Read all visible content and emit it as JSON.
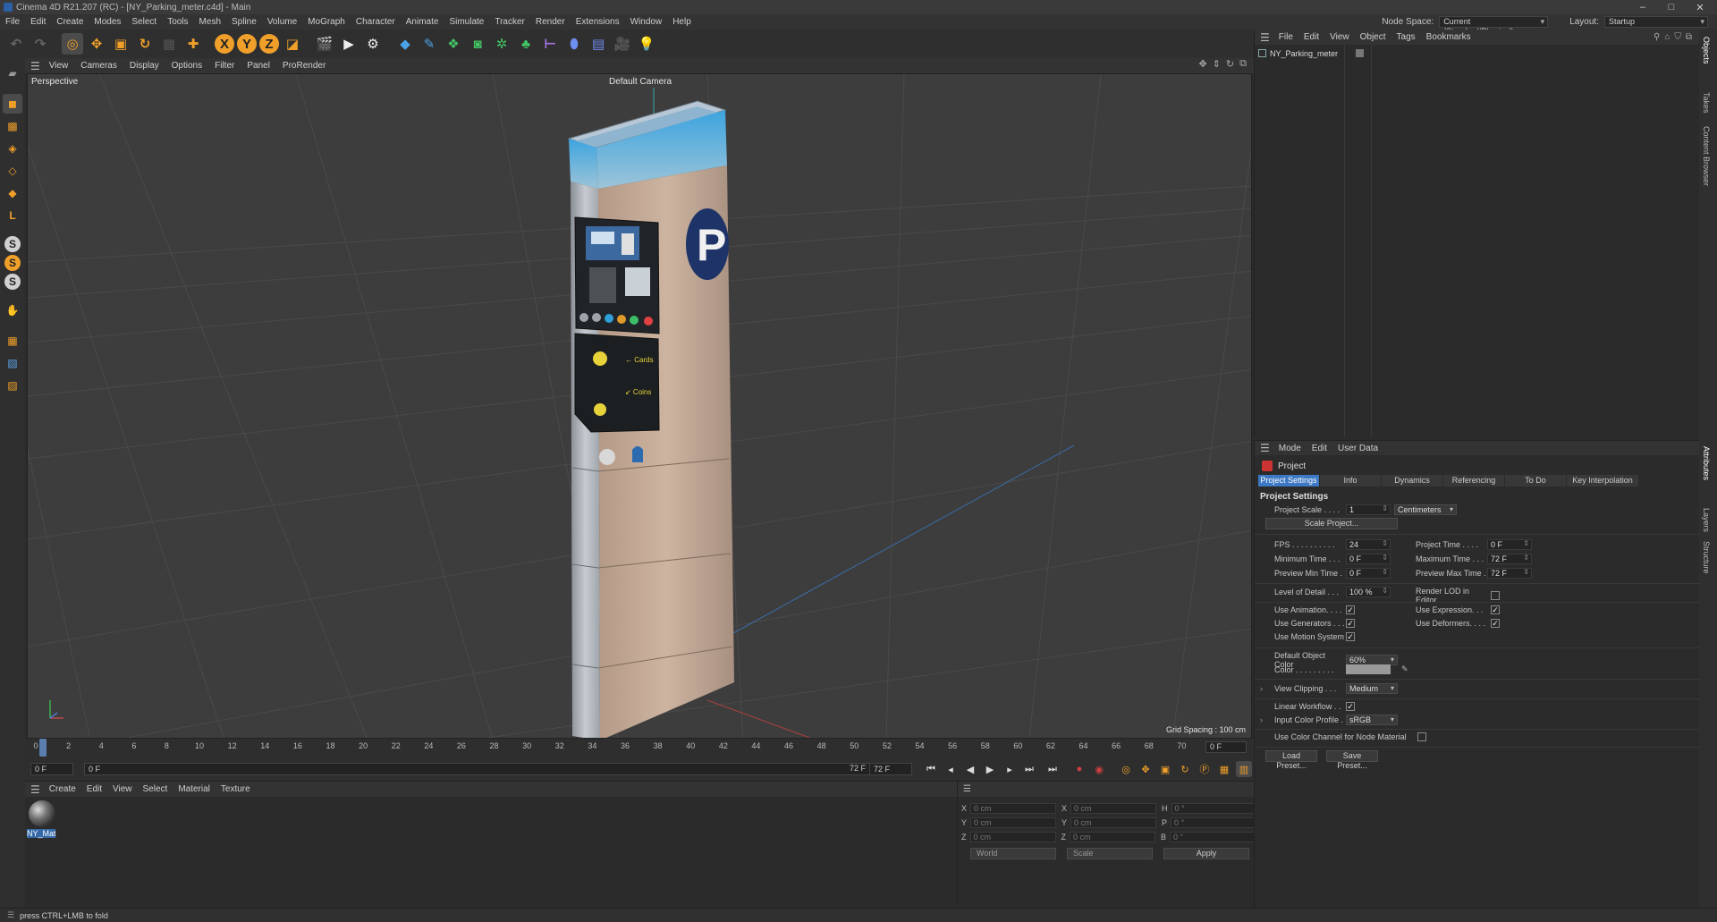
{
  "window": {
    "title": "Cinema 4D R21.207 (RC) - [NY_Parking_meter.c4d] - Main",
    "controls": [
      "–",
      "□",
      "✕"
    ]
  },
  "menubar": {
    "items": [
      "File",
      "Edit",
      "Create",
      "Modes",
      "Select",
      "Tools",
      "Mesh",
      "Spline",
      "Volume",
      "MoGraph",
      "Character",
      "Animate",
      "Simulate",
      "Tracker",
      "Render",
      "Extensions",
      "Window",
      "Help"
    ],
    "node_space_label": "Node Space:",
    "node_space_value": "Current (Standard/Physical)",
    "layout_label": "Layout:",
    "layout_value": "Startup"
  },
  "toolbar": {
    "axis_x": "X",
    "axis_y": "Y",
    "axis_z": "Z"
  },
  "left_toolbar": {
    "s1": "S",
    "s2": "S",
    "s3": "S",
    "l": "L"
  },
  "viewport": {
    "menu": [
      "View",
      "Cameras",
      "Display",
      "Options",
      "Filter",
      "Panel",
      "ProRender"
    ],
    "label": "Perspective",
    "camera": "Default Camera",
    "grid_spacing": "Grid Spacing : 100 cm",
    "sign_letter": "P",
    "label_cards": "← Cards",
    "label_coins": "↙ Coins"
  },
  "timeline": {
    "ticks": [
      "0",
      "2",
      "4",
      "6",
      "8",
      "10",
      "12",
      "14",
      "16",
      "18",
      "20",
      "22",
      "24",
      "26",
      "28",
      "30",
      "32",
      "34",
      "36",
      "38",
      "40",
      "42",
      "44",
      "46",
      "48",
      "50",
      "52",
      "54",
      "56",
      "58",
      "60",
      "62",
      "64",
      "66",
      "68",
      "70",
      "72"
    ],
    "current_frame": "0 F",
    "start_field": "0 F",
    "range_start": "0 F",
    "range_end": "72 F",
    "end_field": "72 F"
  },
  "material_manager": {
    "menu": [
      "Create",
      "Edit",
      "View",
      "Select",
      "Material",
      "Texture"
    ],
    "materials": [
      {
        "name": "NY_Mat"
      }
    ]
  },
  "coordinates": {
    "rows": [
      {
        "a": "X",
        "av": "0 cm",
        "b": "X",
        "bv": "0 cm",
        "c": "H",
        "cv": "0 °"
      },
      {
        "a": "Y",
        "av": "0 cm",
        "b": "Y",
        "bv": "0 cm",
        "c": "P",
        "cv": "0 °"
      },
      {
        "a": "Z",
        "av": "0 cm",
        "b": "Z",
        "bv": "0 cm",
        "c": "B",
        "cv": "0 °"
      }
    ],
    "mode1": "World",
    "mode2": "Scale",
    "apply": "Apply"
  },
  "object_manager": {
    "menu": [
      "File",
      "Edit",
      "View",
      "Object",
      "Tags",
      "Bookmarks"
    ],
    "objects": [
      {
        "name": "NY_Parking_meter"
      }
    ]
  },
  "right_tabs": [
    "Objects",
    "Takes",
    "Content Browser",
    "Attributes",
    "Layers",
    "Structure"
  ],
  "attributes": {
    "menu": [
      "Mode",
      "Edit",
      "User Data"
    ],
    "object": "Project",
    "tabs": [
      "Project Settings",
      "Info",
      "Dynamics",
      "Referencing",
      "To Do",
      "Key Interpolation"
    ],
    "section": "Project Settings",
    "project_scale_label": "Project Scale . . . .",
    "project_scale_value": "1",
    "project_scale_unit": "Centimeters",
    "scale_project_btn": "Scale Project...",
    "fps_label": "FPS . . . . . . . . . .",
    "fps_value": "24",
    "project_time_label": "Project Time . . . .",
    "project_time_value": "0 F",
    "min_time_label": "Minimum Time . . .",
    "min_time_value": "0 F",
    "max_time_label": "Maximum Time . . .",
    "max_time_value": "72 F",
    "prev_min_label": "Preview Min Time .",
    "prev_min_value": "0 F",
    "prev_max_label": "Preview Max Time .",
    "prev_max_value": "72 F",
    "lod_label": "Level of Detail . . .",
    "lod_value": "100 %",
    "render_lod_label": "Render LOD in Editor",
    "use_anim_label": "Use Animation. . . .",
    "use_expr_label": "Use Expression. . .",
    "use_gen_label": "Use Generators . . .",
    "use_def_label": "Use Deformers. . . .",
    "use_motion_label": "Use Motion System",
    "def_obj_color_label": "Default Object Color",
    "def_obj_color_value": "60% Gray",
    "color_label": "Color . . . . . . . . .",
    "view_clip_label": "View Clipping . . .",
    "view_clip_value": "Medium",
    "linear_wf_label": "Linear Workflow . .",
    "input_profile_label": "Input Color Profile .",
    "input_profile_value": "sRGB",
    "use_color_channel_label": "Use Color Channel for Node Material",
    "load_preset": "Load Preset...",
    "save_preset": "Save Preset...",
    "check": "✓"
  },
  "status": {
    "text": "press CTRL+LMB to fold"
  }
}
